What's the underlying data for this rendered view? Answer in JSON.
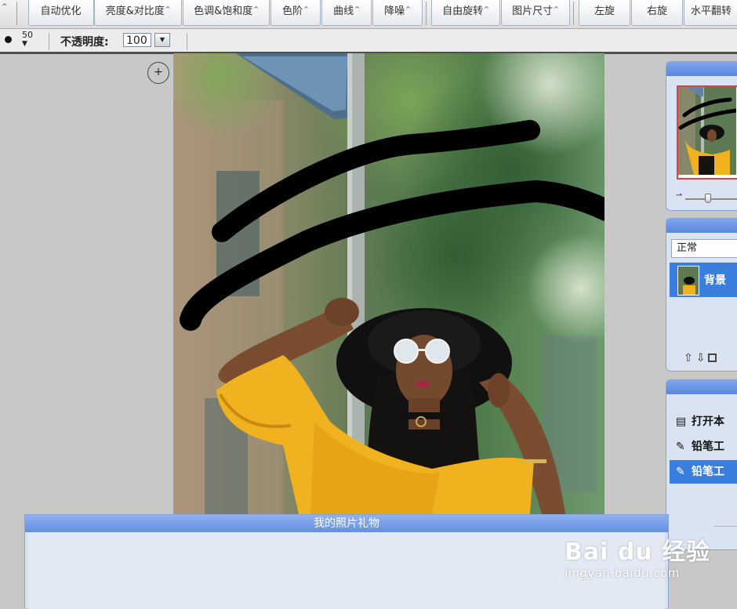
{
  "toolbar": {
    "left_caret": "^",
    "buttons": [
      {
        "label": "自动优化",
        "caret": ""
      },
      {
        "label": "亮度&对比度",
        "caret": "^"
      },
      {
        "label": "色调&饱和度",
        "caret": "^"
      },
      {
        "label": "色阶",
        "caret": "^"
      },
      {
        "label": "曲线",
        "caret": "^"
      },
      {
        "label": "降噪",
        "caret": "^"
      },
      {
        "label": "自由旋转",
        "caret": "^"
      },
      {
        "label": "图片尺寸",
        "caret": "^"
      },
      {
        "label": "左旋",
        "caret": ""
      },
      {
        "label": "右旋",
        "caret": ""
      },
      {
        "label": "水平翻转",
        "caret": ""
      }
    ]
  },
  "options": {
    "brush_size": "50",
    "opacity_label": "不透明度:",
    "opacity_value": "100"
  },
  "canvas": {
    "zoom_symbol": "+"
  },
  "navigator": {
    "zoom_level": 0.35
  },
  "layers": {
    "blend_mode": "正常",
    "items": [
      {
        "name": "背景"
      }
    ]
  },
  "history": {
    "items": [
      {
        "label": "打开本",
        "icon": "open-file-icon",
        "selected": false
      },
      {
        "label": "铅笔工",
        "icon": "pencil-icon",
        "selected": false
      },
      {
        "label": "铅笔工",
        "icon": "pencil-icon",
        "selected": true
      }
    ]
  },
  "gift_panel": {
    "title": "我的照片礼物"
  },
  "watermark": {
    "logo": "Bai du 经验",
    "url": "jingyan.baidu.com"
  }
}
